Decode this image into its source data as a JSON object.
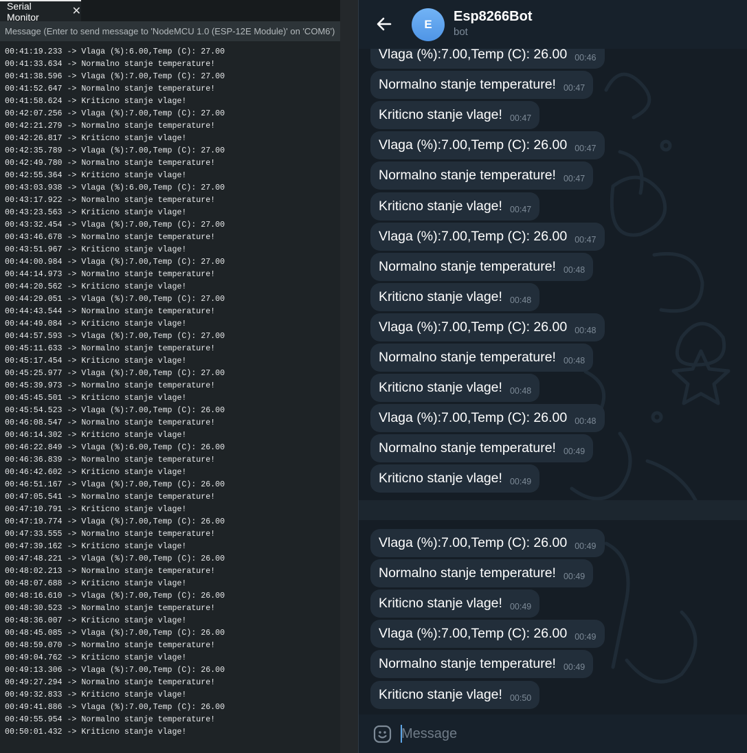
{
  "serial_monitor": {
    "tab_label": "Serial Monitor",
    "close_glyph": "✕",
    "input_placeholder": "Message (Enter to send message to 'NodeMCU 1.0 (ESP-12E Module)' on 'COM6')",
    "lines": [
      "00:41:19.233 -> Vlaga (%):6.00,Temp (C): 27.00",
      "00:41:33.634 -> Normalno stanje temperature!",
      "00:41:38.596 -> Vlaga (%):7.00,Temp (C): 27.00",
      "00:41:52.647 -> Normalno stanje temperature!",
      "00:41:58.624 -> Kriticno stanje vlage!",
      "00:42:07.256 -> Vlaga (%):7.00,Temp (C): 27.00",
      "00:42:21.279 -> Normalno stanje temperature!",
      "00:42:26.817 -> Kriticno stanje vlage!",
      "00:42:35.789 -> Vlaga (%):7.00,Temp (C): 27.00",
      "00:42:49.780 -> Normalno stanje temperature!",
      "00:42:55.364 -> Kriticno stanje vlage!",
      "00:43:03.938 -> Vlaga (%):6.00,Temp (C): 27.00",
      "00:43:17.922 -> Normalno stanje temperature!",
      "00:43:23.563 -> Kriticno stanje vlage!",
      "00:43:32.454 -> Vlaga (%):7.00,Temp (C): 27.00",
      "00:43:46.678 -> Normalno stanje temperature!",
      "00:43:51.967 -> Kriticno stanje vlage!",
      "00:44:00.984 -> Vlaga (%):7.00,Temp (C): 27.00",
      "00:44:14.973 -> Normalno stanje temperature!",
      "00:44:20.562 -> Kriticno stanje vlage!",
      "00:44:29.051 -> Vlaga (%):7.00,Temp (C): 27.00",
      "00:44:43.544 -> Normalno stanje temperature!",
      "00:44:49.084 -> Kriticno stanje vlage!",
      "00:44:57.593 -> Vlaga (%):7.00,Temp (C): 27.00",
      "00:45:11.633 -> Normalno stanje temperature!",
      "00:45:17.454 -> Kriticno stanje vlage!",
      "00:45:25.977 -> Vlaga (%):7.00,Temp (C): 27.00",
      "00:45:39.973 -> Normalno stanje temperature!",
      "00:45:45.501 -> Kriticno stanje vlage!",
      "00:45:54.523 -> Vlaga (%):7.00,Temp (C): 26.00",
      "00:46:08.547 -> Normalno stanje temperature!",
      "00:46:14.302 -> Kriticno stanje vlage!",
      "00:46:22.849 -> Vlaga (%):6.00,Temp (C): 26.00",
      "00:46:36.839 -> Normalno stanje temperature!",
      "00:46:42.602 -> Kriticno stanje vlage!",
      "00:46:51.167 -> Vlaga (%):7.00,Temp (C): 26.00",
      "00:47:05.541 -> Normalno stanje temperature!",
      "00:47:10.791 -> Kriticno stanje vlage!",
      "00:47:19.774 -> Vlaga (%):7.00,Temp (C): 26.00",
      "00:47:33.555 -> Normalno stanje temperature!",
      "00:47:39.162 -> Kriticno stanje vlage!",
      "00:47:48.221 -> Vlaga (%):7.00,Temp (C): 26.00",
      "00:48:02.213 -> Normalno stanje temperature!",
      "00:48:07.688 -> Kriticno stanje vlage!",
      "00:48:16.610 -> Vlaga (%):7.00,Temp (C): 26.00",
      "00:48:30.523 -> Normalno stanje temperature!",
      "00:48:36.007 -> Kriticno stanje vlage!",
      "00:48:45.085 -> Vlaga (%):7.00,Temp (C): 26.00",
      "00:48:59.070 -> Normalno stanje temperature!",
      "00:49:04.762 -> Kriticno stanje vlage!",
      "00:49:13.306 -> Vlaga (%):7.00,Temp (C): 26.00",
      "00:49:27.294 -> Normalno stanje temperature!",
      "00:49:32.833 -> Kriticno stanje vlage!",
      "00:49:41.886 -> Vlaga (%):7.00,Temp (C): 26.00",
      "00:49:55.954 -> Normalno stanje temperature!",
      "00:50:01.432 -> Kriticno stanje vlage!"
    ]
  },
  "telegram": {
    "header": {
      "back_icon": "arrow-left-icon",
      "avatar_letter": "E",
      "title": "Esp8266Bot",
      "subtitle": "bot"
    },
    "messages": [
      {
        "text": "Vlaga (%):7.00,Temp (C): 26.00",
        "time": "00:46"
      },
      {
        "text": "Normalno stanje temperature!",
        "time": "00:47"
      },
      {
        "text": "Kriticno stanje vlage!",
        "time": "00:47"
      },
      {
        "text": "Vlaga (%):7.00,Temp (C): 26.00",
        "time": "00:47"
      },
      {
        "text": "Normalno stanje temperature!",
        "time": "00:47"
      },
      {
        "text": "Kriticno stanje vlage!",
        "time": "00:47"
      },
      {
        "text": "Vlaga (%):7.00,Temp (C): 26.00",
        "time": "00:47"
      },
      {
        "text": "Normalno stanje temperature!",
        "time": "00:48"
      },
      {
        "text": "Kriticno stanje vlage!",
        "time": "00:48"
      },
      {
        "text": "Vlaga (%):7.00,Temp (C): 26.00",
        "time": "00:48"
      },
      {
        "text": "Normalno stanje temperature!",
        "time": "00:48"
      },
      {
        "text": "Kriticno stanje vlage!",
        "time": "00:48"
      },
      {
        "text": "Vlaga (%):7.00,Temp (C): 26.00",
        "time": "00:48"
      },
      {
        "text": "Normalno stanje temperature!",
        "time": "00:49"
      },
      {
        "text": "Kriticno stanje vlage!",
        "time": "00:49"
      },
      {
        "text": "Vlaga (%):7.00,Temp (C): 26.00",
        "time": "00:49"
      },
      {
        "text": "Normalno stanje temperature!",
        "time": "00:49"
      },
      {
        "text": "Kriticno stanje vlage!",
        "time": "00:49"
      },
      {
        "text": "Vlaga (%):7.00,Temp (C): 26.00",
        "time": "00:49"
      },
      {
        "text": "Normalno stanje temperature!",
        "time": "00:49"
      },
      {
        "text": "Kriticno stanje vlage!",
        "time": "00:50"
      }
    ],
    "composer": {
      "emoji_icon": "emoji-smile-icon",
      "placeholder": "Message"
    }
  }
}
